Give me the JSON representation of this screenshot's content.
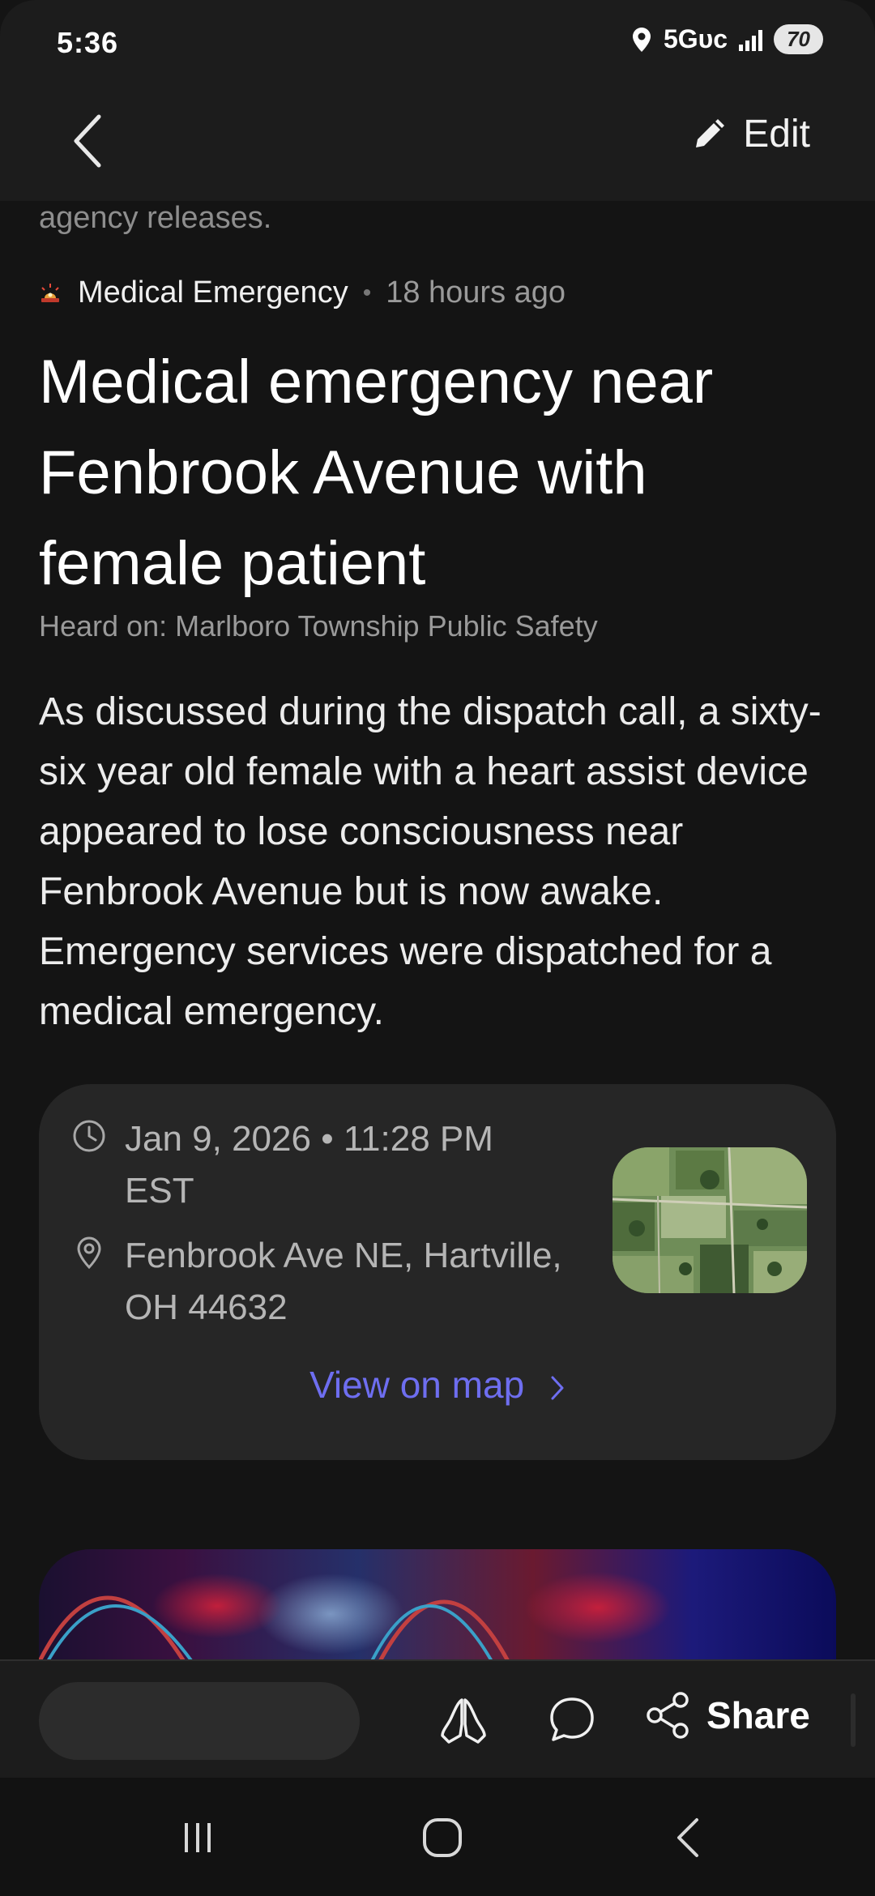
{
  "status_bar": {
    "time": "5:36",
    "network": "5Gᴜᴄ",
    "battery": "70"
  },
  "header": {
    "back_icon": "chevron-left-icon",
    "edit_label": "Edit",
    "edit_icon": "pencil-icon"
  },
  "article": {
    "previous_snippet": "agency releases.",
    "category": "Medical Emergency",
    "category_icon": "emergency-siren-icon",
    "time_ago": "18 hours ago",
    "title": "Medical emergency near Fenbrook Avenue with female patient",
    "heard_on": "Heard on: Marlboro Township Public Safety",
    "body": "As discussed during the dispatch call, a sixty-six year old female with a heart assist device appeared to lose consciousness near Fenbrook Avenue but is now awake. Emergency services were dispatched for a medical emergency."
  },
  "info_card": {
    "datetime": "Jan 9, 2026 • 11:28 PM EST",
    "address": "Fenbrook Ave NE, Hartville, OH 44632",
    "view_on_map": "View on map",
    "accent_color": "#6e6ef0"
  },
  "action_bar": {
    "share_label": "Share",
    "icons": [
      "praying-hands-icon",
      "comment-icon",
      "share-icon"
    ]
  },
  "nav_bar": {
    "icons": [
      "recent-apps-icon",
      "home-icon",
      "back-icon"
    ]
  }
}
